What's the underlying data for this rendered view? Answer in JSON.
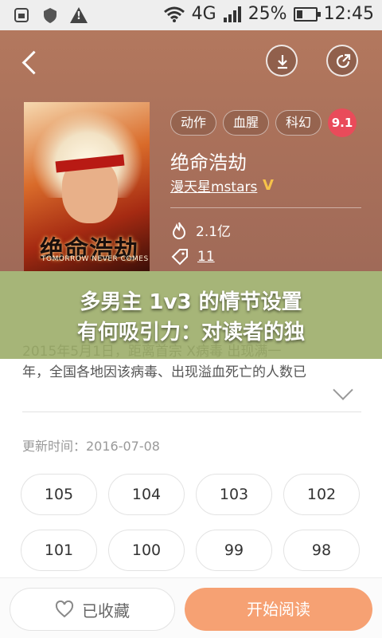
{
  "status_bar": {
    "network": "4G",
    "battery": "25%",
    "time": "12:45"
  },
  "header": {
    "tags": [
      "动作",
      "血腥",
      "科幻"
    ],
    "rating": "9.1",
    "book_title": "绝命浩劫",
    "author": "漫天星mstars",
    "author_badge": "V",
    "hot_count": "2.1亿",
    "comment_count": "11",
    "cover": {
      "title": "绝命浩劫",
      "subtitle": "TOMORROW NEVER COMES"
    }
  },
  "banner": {
    "line1": "多男主 1v3 的情节设置",
    "line2": "有何吸引力：对读者的独"
  },
  "description": {
    "line1": "2015年5月1日，距离首宗 X病毒 出现满一",
    "line2": "年，全国各地因该病毒、出现溢血死亡的人数已"
  },
  "update_time": "更新时间：2016-07-08",
  "chapters": [
    "105",
    "104",
    "103",
    "102",
    "101",
    "100",
    "99",
    "98"
  ],
  "bottom": {
    "favorite_label": "已收藏",
    "read_label": "开始阅读"
  },
  "colors": {
    "header_bg": "#a9705a",
    "rating_bg": "#e94b5a",
    "read_button": "#f6a173",
    "vip_badge": "#f6c24a"
  }
}
